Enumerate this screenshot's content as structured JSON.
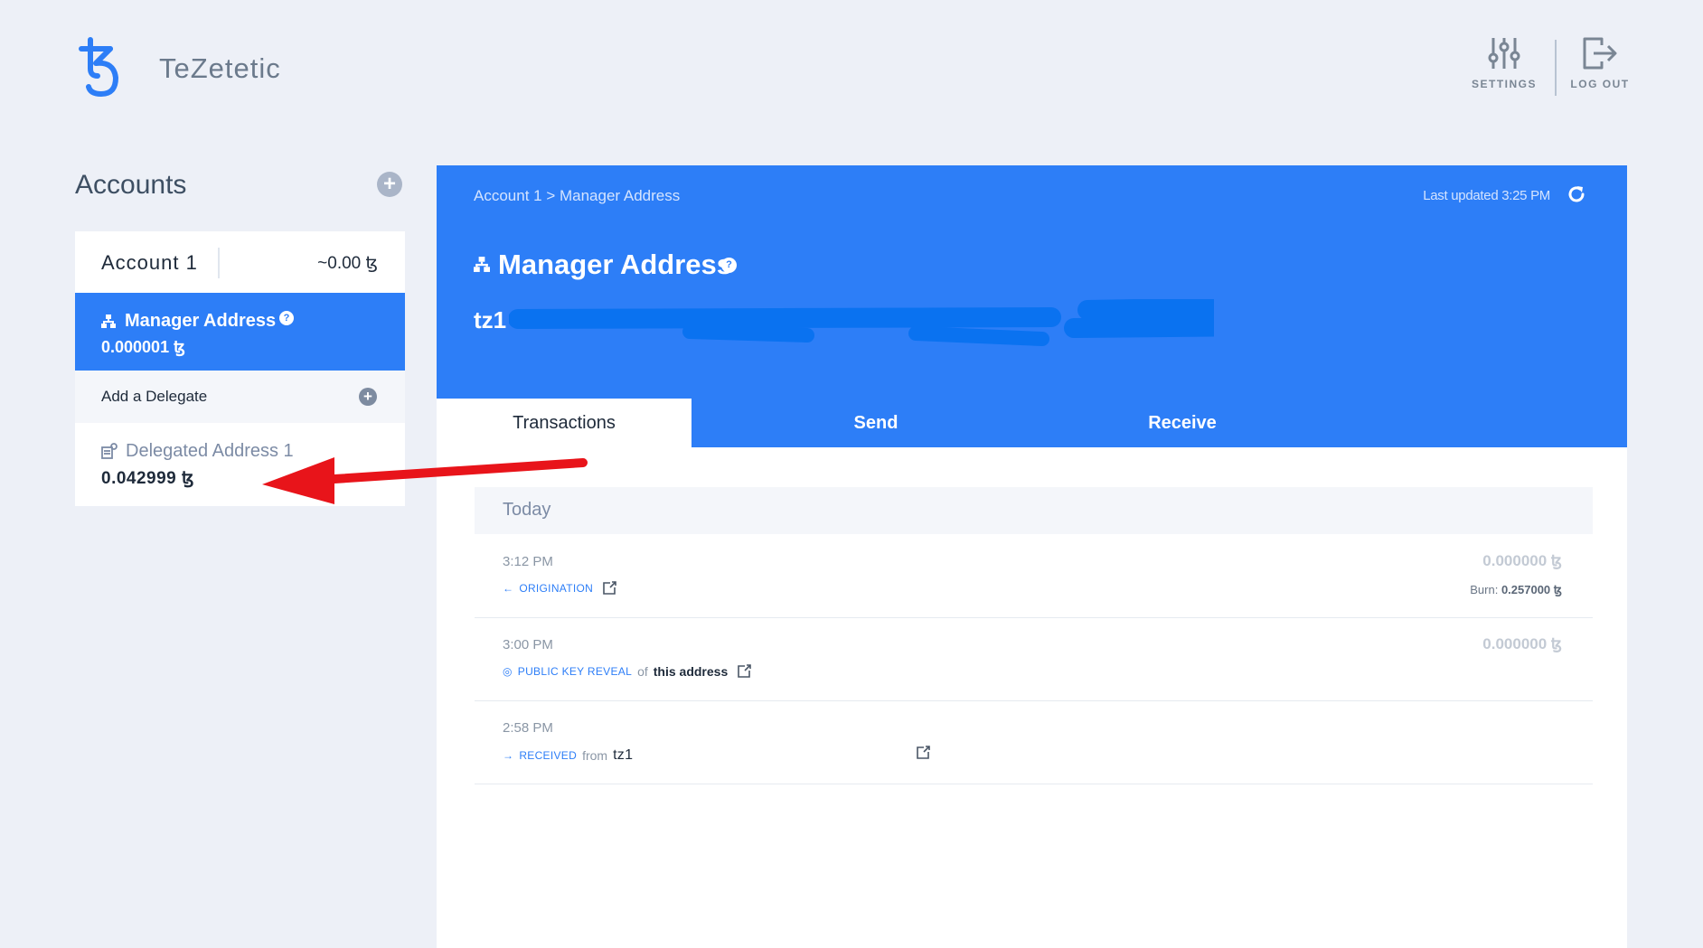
{
  "app": {
    "name": "TeZetetic"
  },
  "header": {
    "settings_label": "SETTINGS",
    "logout_label": "LOG OUT"
  },
  "sidebar": {
    "title": "Accounts",
    "account": {
      "name": "Account 1",
      "balance": "~0.00 ꜩ",
      "manager": {
        "label": "Manager Address",
        "balance": "0.000001 ꜩ"
      },
      "add_delegate_label": "Add a Delegate",
      "delegated": {
        "label": "Delegated Address 1",
        "balance": "0.042999 ꜩ"
      }
    }
  },
  "main": {
    "breadcrumb": "Account 1 > Manager Address",
    "last_updated": "Last updated 3:25 PM",
    "title": "Manager Address",
    "address_prefix": "tz1",
    "tabs": [
      "Transactions",
      "Send",
      "Receive"
    ],
    "day_label": "Today",
    "transactions": [
      {
        "time": "3:12 PM",
        "kind": "ORIGINATION",
        "amount": "0.000000 ꜩ",
        "burn_label": "Burn:",
        "burn_value": "0.257000 ꜩ"
      },
      {
        "time": "3:00 PM",
        "kind": "PUBLIC KEY REVEAL",
        "of": "of",
        "target": "this address",
        "amount": "0.000000 ꜩ"
      },
      {
        "time": "2:58 PM",
        "kind": "RECEIVED",
        "from": "from",
        "address": "tz1"
      }
    ]
  },
  "colors": {
    "accent": "#2d7ef7",
    "background": "#edf0f7",
    "annotation_arrow": "#e8141a"
  }
}
